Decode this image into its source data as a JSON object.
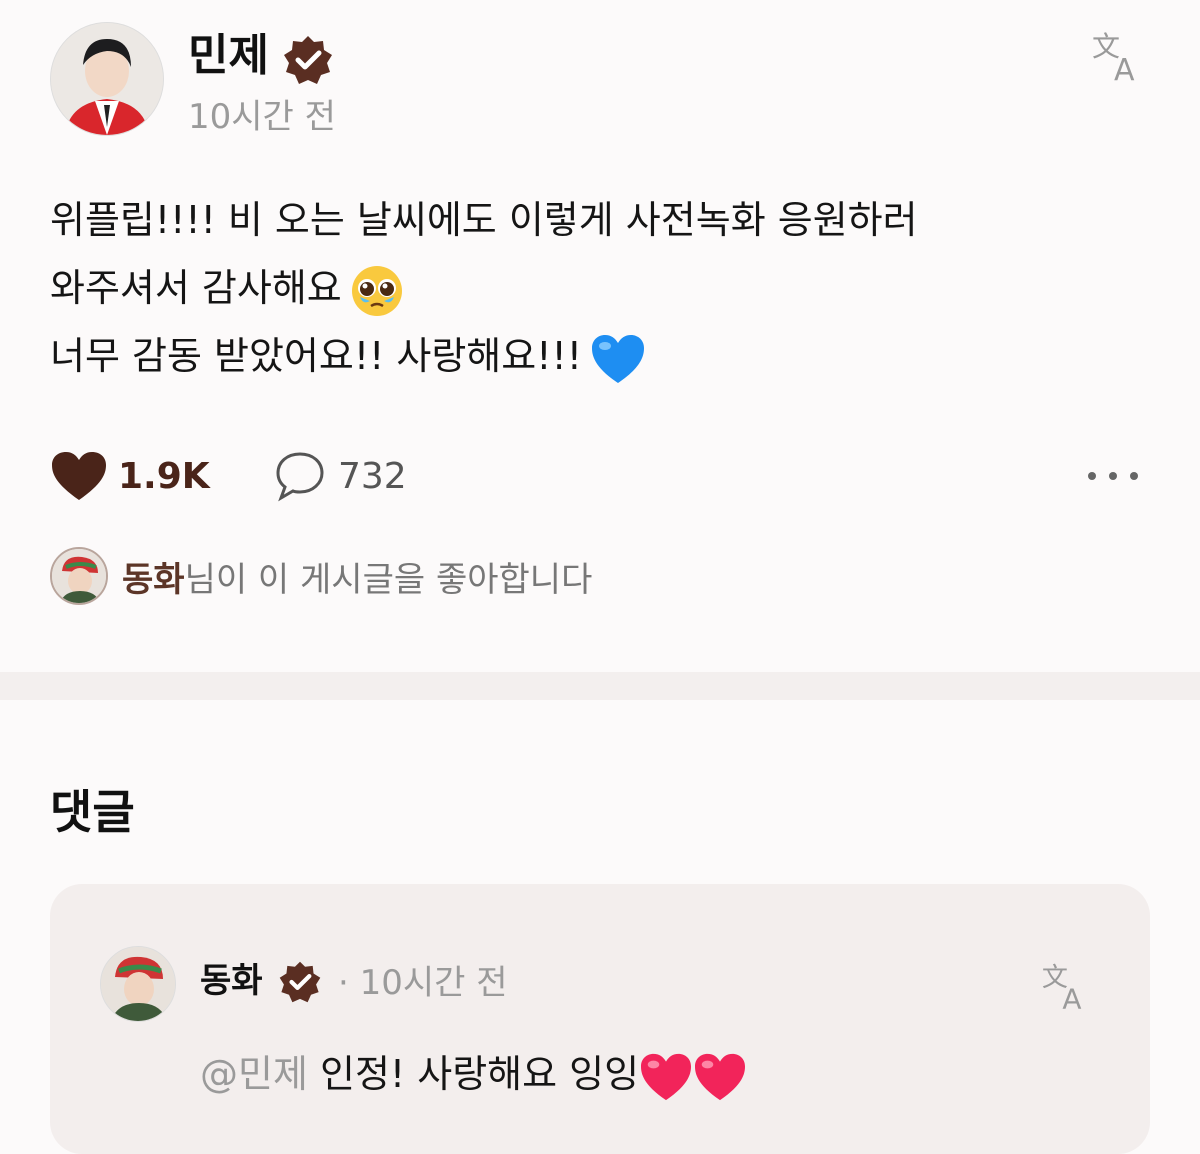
{
  "post": {
    "author": "민제",
    "time": "10시간 전",
    "lines": [
      "위플립!!!! 비 오는 날씨에도 이렇게 사전녹화 응원하러",
      "와주셔서 감사해요",
      "너무 감동 받았어요!! 사랑해요!!!"
    ],
    "likes": "1.9K",
    "comments": "732",
    "liked_by_name": "동화",
    "liked_by_text": "님이 이 게시글을 좋아합니다"
  },
  "comments_section": {
    "title": "댓글",
    "items": [
      {
        "author": "동화",
        "time": "· 10시간 전",
        "mention": "@민제",
        "text": " 인정! 사랑해요 잉잉"
      }
    ]
  },
  "colors": {
    "accent": "#4a2419",
    "verified": "#5a2e22",
    "muted": "#9a9a9a",
    "comment_bg": "#f3eeed"
  },
  "icons": [
    "verified-badge-icon",
    "translate-icon",
    "heart-icon",
    "comment-bubble-icon",
    "more-icon",
    "pleading-face-emoji",
    "blue-heart-emoji",
    "pink-heart-emoji"
  ]
}
